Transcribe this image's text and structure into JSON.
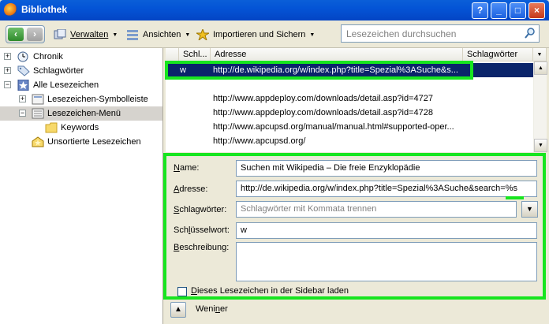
{
  "window": {
    "title": "Bibliothek",
    "buttons": [
      "?",
      "_",
      "□",
      "×"
    ]
  },
  "toolbar": {
    "verwalten": "Verwalten",
    "ansichten": "Ansichten",
    "import": "Importieren und Sichern",
    "search_placeholder": "Lesezeichen durchsuchen"
  },
  "tree": [
    {
      "label": "Chronik",
      "icon": "clock-icon",
      "twisty": "+"
    },
    {
      "label": "Schlagwörter",
      "icon": "tag-icon",
      "twisty": "+"
    },
    {
      "label": "Alle Lesezeichen",
      "icon": "star-icon",
      "twisty": "−"
    },
    {
      "label": "Lesezeichen-Symbolleiste",
      "icon": "bookmark-toolbar-icon",
      "twisty": "+"
    },
    {
      "label": "Lesezeichen-Menü",
      "icon": "bookmark-menu-icon",
      "twisty": "−"
    },
    {
      "label": "Keywords",
      "icon": "folder-icon",
      "twisty": ""
    },
    {
      "label": "Unsortierte Lesezeichen",
      "icon": "unsorted-icon",
      "twisty": ""
    }
  ],
  "list": {
    "columns": [
      "Schl...",
      "Adresse",
      "Schlagwörter"
    ],
    "rows": [
      {
        "keyword": "w",
        "address": "http://de.wikipedia.org/w/index.php?title=Spezial%3ASuche&s...",
        "tags": ""
      },
      {
        "keyword": "",
        "address": "",
        "tags": ""
      },
      {
        "keyword": "",
        "address": "http://www.appdeploy.com/downloads/detail.asp?id=4727",
        "tags": ""
      },
      {
        "keyword": "",
        "address": "http://www.appdeploy.com/downloads/detail.asp?id=4728",
        "tags": ""
      },
      {
        "keyword": "",
        "address": "http://www.apcupsd.org/manual/manual.html#supported-oper...",
        "tags": ""
      },
      {
        "keyword": "",
        "address": "http://www.apcupsd.org/",
        "tags": ""
      }
    ]
  },
  "details": {
    "name_label": "Name:",
    "name_value": "Suchen mit Wikipedia – Die freie Enzyklopädie",
    "address_label": "Adresse:",
    "address_value": "http://de.wikipedia.org/w/index.php?title=Spezial%3ASuche&search=%s",
    "tags_label": "Schlagwörter:",
    "tags_placeholder": "Schlagwörter mit Kommata trennen",
    "keyword_label": "Schlüsselwort:",
    "keyword_value": "w",
    "description_label": "Beschreibung:",
    "description_value": "",
    "sidebar_checkbox": "Dieses Lesezeichen in der Sidebar laden"
  },
  "footer": {
    "less_label": "Weniger"
  },
  "colors": {
    "highlight": "#17e51f",
    "selection": "#0a246a"
  }
}
